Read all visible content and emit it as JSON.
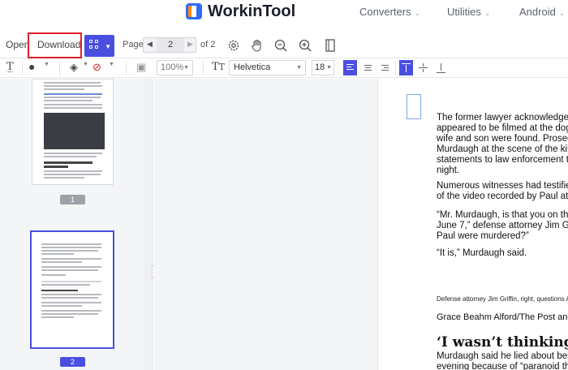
{
  "site": {
    "brand": "WorkinTool",
    "nav": [
      {
        "label": "Converters"
      },
      {
        "label": "Utilities"
      },
      {
        "label": "Android"
      }
    ]
  },
  "toolbar": {
    "open_label": "Open",
    "download_label": "Download",
    "page_label": "Page",
    "current_page": "2",
    "of_label": "of 2",
    "zoom": "100%",
    "font": "Helvetica",
    "font_size": "18",
    "accent_color": "#4a4fe0",
    "highlight_color": "#e0202a"
  },
  "sidebar": {
    "pages": [
      {
        "label": "1",
        "selected": false
      },
      {
        "label": "2",
        "selected": true
      }
    ]
  },
  "document": {
    "paragraph1": [
      "The former lawyer acknowledge",
      "appeared to be filmed at the dog",
      "wife and son were found. Prosec",
      "Murdaugh at the scene of the kil",
      "statements to law enforcement t",
      "night."
    ],
    "paragraph2": [
      "Numerous witnesses had testifie",
      "of the video recorded by Paul at"
    ],
    "paragraph3": [
      "“Mr. Murdaugh, is that you on th",
      "June 7,” defense attorney Jim G",
      "Paul were murdered?”"
    ],
    "paragraph4": "“It is,” Murdaugh said.",
    "caption": "Defense attorney Jim Griffin, right, questions Alex M",
    "credit": "Grace Beahm Alford/The Post and",
    "heading": "‘I wasn’t thinking clearly",
    "paragraph5": [
      "Murdaugh said he lied about bei",
      "evening because of “paranoid th"
    ]
  }
}
